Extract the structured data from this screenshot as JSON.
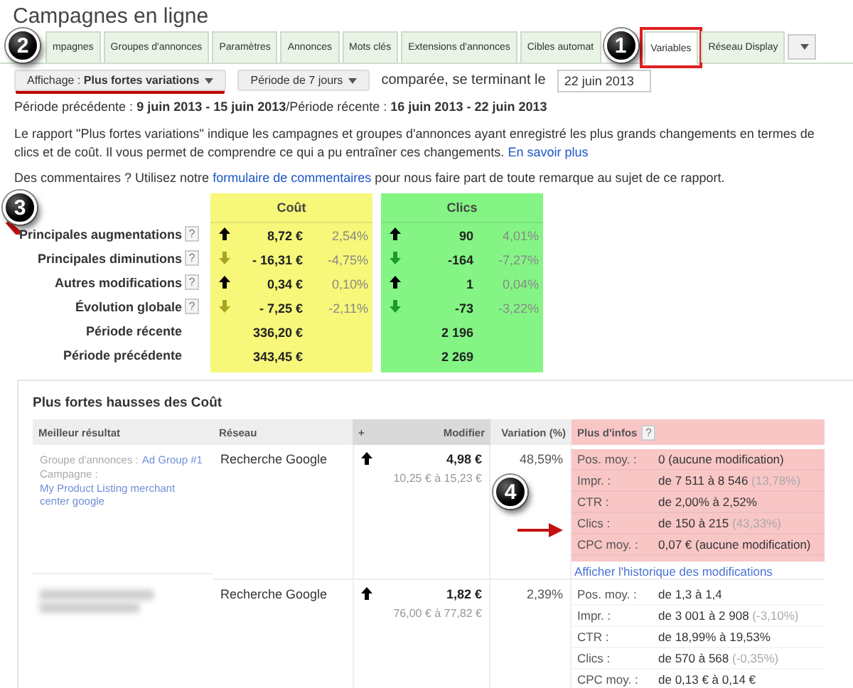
{
  "page_title": "Campagnes en ligne",
  "tabs": [
    {
      "label": "mpagnes",
      "selected": false,
      "outlined": false
    },
    {
      "label": "Groupes d'annonces",
      "selected": false,
      "outlined": false
    },
    {
      "label": "Paramètres",
      "selected": false,
      "outlined": false
    },
    {
      "label": "Annonces",
      "selected": false,
      "outlined": false
    },
    {
      "label": "Mots clés",
      "selected": false,
      "outlined": false
    },
    {
      "label": "Extensions d'annonces",
      "selected": false,
      "outlined": false
    },
    {
      "label": "Cibles automat",
      "selected": false,
      "outlined": false
    },
    {
      "label": "Variables",
      "selected": true,
      "outlined": true
    },
    {
      "label": "Réseau Display",
      "selected": false,
      "outlined": false
    }
  ],
  "view_button": {
    "label": "Affichage : **Plus fortes variations**",
    "underlined": true
  },
  "period_button": {
    "label": "Période de 7 jours"
  },
  "compare_label": "comparée, se terminant le",
  "end_date": {
    "value": "22 juin 2013"
  },
  "period_line": "Période précédente : **9 juin 2013 - 15 juin 2013**/Période récente : **16 juin 2013 - 22 juin 2013**",
  "description": {
    "text": "Le rapport \"Plus fortes variations\" indique les campagnes et groupes d'annonces ayant enregistré les plus grands changements en termes de clics et de coût. Il vous permet de comprendre ce qui a pu entraîner ces changements.",
    "link": "En savoir plus"
  },
  "feedback": {
    "before": "Des commentaires ? Utilisez notre",
    "link": "formulaire de commentaires",
    "after": "pour nous faire part de toute remarque au sujet de ce rapport."
  },
  "summary": {
    "columns": [
      {
        "title": "Coût",
        "color": "#f7f77a"
      },
      {
        "title": "Clics",
        "color": "#84f584"
      }
    ],
    "rows": [
      {
        "label": "Principales augmentations",
        "help": "?",
        "cells": [
          {
            "increase": true,
            "value": "8,72 €",
            "pct": "2,54%"
          },
          {
            "increase": true,
            "value": "90",
            "pct": "4,01%"
          }
        ]
      },
      {
        "label": "Principales diminutions",
        "help": "?",
        "cells": [
          {
            "increase": false,
            "value": "- 16,31 €",
            "pct": "-4,75%"
          },
          {
            "increase": false,
            "value": "-164",
            "pct": "-7,27%"
          }
        ]
      },
      {
        "label": "Autres modifications",
        "help": "?",
        "cells": [
          {
            "increase": true,
            "value": "0,34 €",
            "pct": "0,10%"
          },
          {
            "increase": true,
            "value": "1",
            "pct": "0,04%"
          }
        ]
      },
      {
        "label": "Évolution globale",
        "help": "?",
        "cells": [
          {
            "increase": false,
            "value": "- 7,25 €",
            "pct": "-2,11%"
          },
          {
            "increase": false,
            "value": "-73",
            "pct": "-3,22%"
          }
        ]
      },
      {
        "label": "Période récente",
        "cells": [
          {
            "value": "336,20 €"
          },
          {
            "value": "2 196"
          }
        ]
      },
      {
        "label": "Période précédente",
        "cells": [
          {
            "value": "343,45 €"
          },
          {
            "value": "2 269"
          }
        ]
      }
    ]
  },
  "detail": {
    "title": "Plus fortes hausses des Coût",
    "columns": [
      {
        "label": "Meilleur résultat",
        "sorted": false
      },
      {
        "label": "Réseau",
        "sorted": false
      },
      {
        "label": "+",
        "sorted": true
      },
      {
        "label": "Modifier",
        "sorted": true
      },
      {
        "label": "Variation (%)",
        "sorted": false
      },
      {
        "label": "Plus d'infos",
        "sorted": false,
        "help": "?"
      }
    ],
    "rows": [
      {
        "highlighted": true,
        "ad_group_label": "Groupe d'annonces :",
        "ad_group": "Ad Group #1",
        "campaign_label": "Campagne :",
        "campaign": "My Product Listing merchant center google",
        "network": "Recherche Google",
        "increase": true,
        "change": "4,98 €",
        "range": "10,25 € à 15,23 €",
        "variation": "48,59%",
        "metrics": [
          {
            "label": "Pos. moy. :",
            "value": "0 (aucune modification)"
          },
          {
            "label": "Impr. :",
            "value": "de 7 511 à 8 546",
            "delta": "(13,78%)"
          },
          {
            "label": "CTR :",
            "value": "de 2,00% à 2,52%"
          },
          {
            "label": "Clics :",
            "value": "de 150 à 215",
            "delta": "(43,33%)"
          },
          {
            "label": "CPC moy. :",
            "value": "0,07 € (aucune modification)"
          }
        ],
        "history_link": "Afficher l'historique des modifications"
      },
      {
        "highlighted": false,
        "network": "Recherche Google",
        "increase": true,
        "change": "1,82 €",
        "range": "76,00 € à 77,82 €",
        "variation": "2,39%",
        "metrics": [
          {
            "label": "Pos. moy. :",
            "value": "de 1,3 à 1,4"
          },
          {
            "label": "Impr. :",
            "value": "de 3 001 à 2 908",
            "delta": "(-3,10%)"
          },
          {
            "label": "CTR :",
            "value": "de 18,99% à 19,53%"
          },
          {
            "label": "Clics :",
            "value": "de 570 à 568",
            "delta": "(-0,35%)"
          },
          {
            "label": "CPC moy. :",
            "value": "de 0,13 € à 0,14 €"
          }
        ]
      }
    ]
  },
  "callouts": [
    "1",
    "2",
    "3",
    "4"
  ]
}
